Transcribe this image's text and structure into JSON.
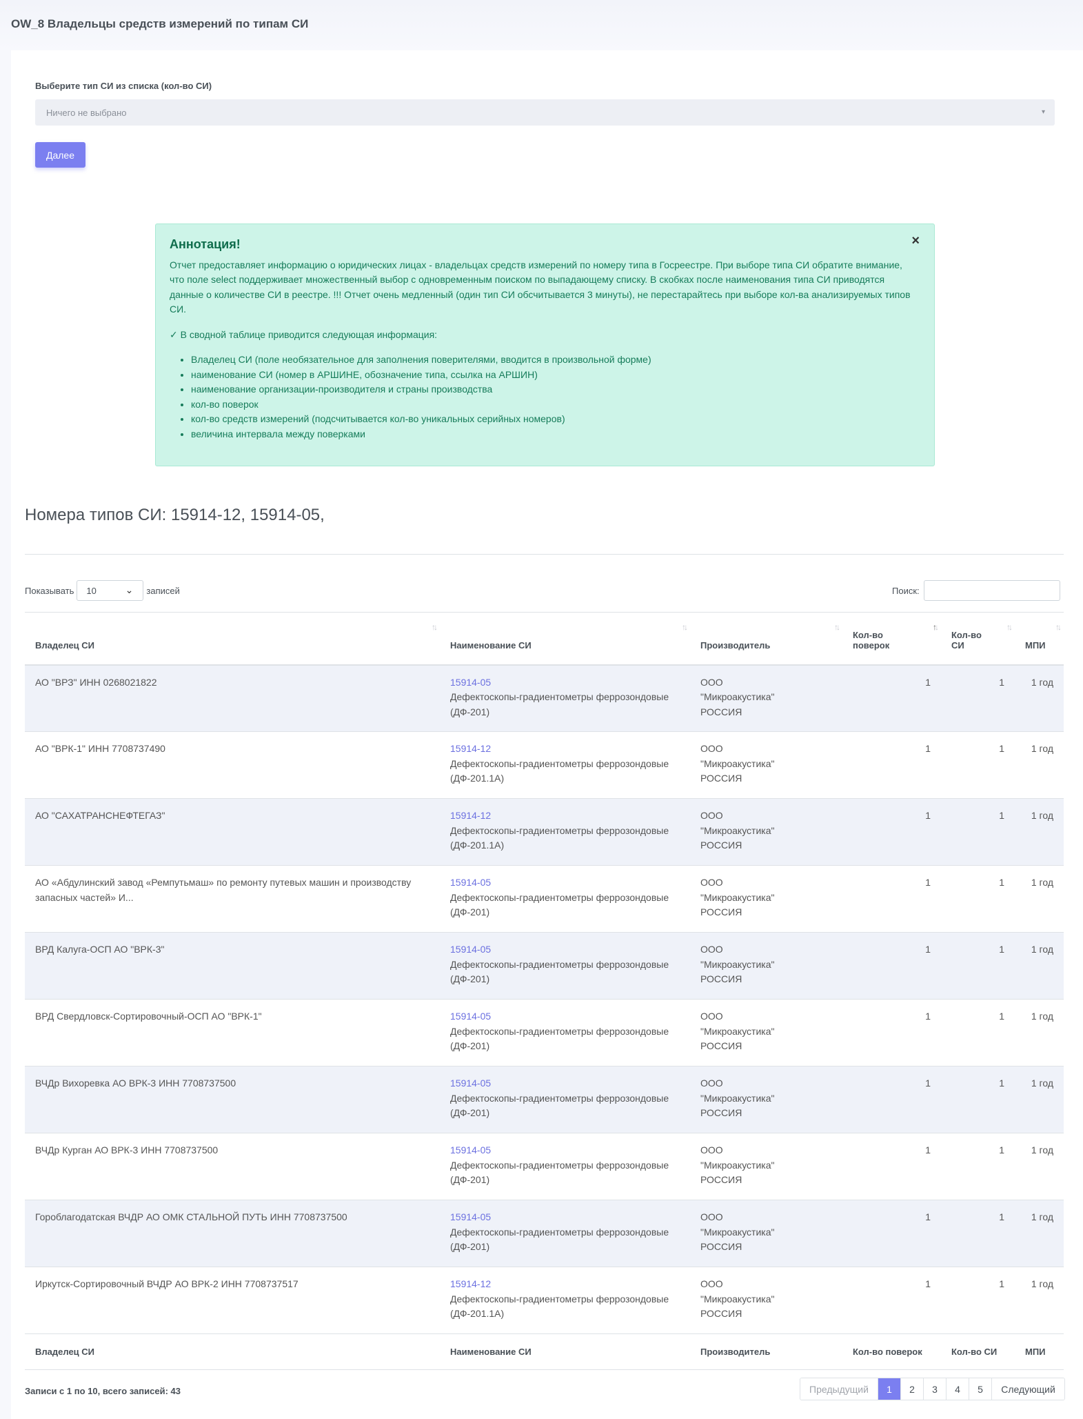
{
  "page": {
    "title": "OW_8 Владельцы средств измерений по типам СИ"
  },
  "form": {
    "label": "Выберите тип СИ из списка (кол-во СИ)",
    "select_placeholder": "Ничего не выбрано",
    "next_button": "Далее"
  },
  "annotation": {
    "title": "Аннотация!",
    "close": "×",
    "text": "Отчет предоставляет информацию о юридических лицах - владельцах средств измерений по номеру типа в Госреестре. При выборе типа СИ обратите внимание, что поле select поддерживает множественный выбор с одновременным поиском по выпадающему списку. В скобках после наименования типа СИ приводятся данные о количестве СИ в реестре. !!! Отчет очень медленный (один тип СИ обсчитывается 3 минуты), не перестарайтесь при выборе кол-ва анализируемых типов СИ.",
    "check_line": "✓ В сводной таблице приводится следующая информация:",
    "items": [
      "Владелец СИ (поле необязательное для заполнения поверителями, вводится в произвольной форме)",
      "наименование СИ (номер в АРШИНЕ, обозначение типа, ссылка на АРШИН)",
      "наименование организации-производителя и страны производства",
      "кол-во поверок",
      "кол-во средств измерений (подсчитывается кол-во уникальных серийных номеров)",
      "величина интервала между поверками"
    ]
  },
  "types_heading": "Номера типов СИ: 15914-12, 15914-05,",
  "table_controls": {
    "show_label": "Показывать",
    "length_value": "10",
    "records_label": "записей",
    "search_label": "Поиск:"
  },
  "table": {
    "headers": [
      "Владелец СИ",
      "Наименование СИ",
      "Производитель",
      "Кол-во поверок",
      "Кол-во СИ",
      "МПИ"
    ],
    "rows": [
      {
        "owner": "АО \"ВРЗ\" ИНН 0268021822",
        "type_no": "15914-05",
        "name": "Дефектоскопы-градиентометры феррозондовые (ДФ-201)",
        "maker": "ООО \"Микроакустика\" РОССИЯ",
        "verifications": "1",
        "count": "1",
        "mpi": "1 год"
      },
      {
        "owner": "АО \"ВРК-1\" ИНН 7708737490",
        "type_no": "15914-12",
        "name": "Дефектоскопы-градиентометры феррозондовые (ДФ-201.1А)",
        "maker": "ООО \"Микроакустика\" РОССИЯ",
        "verifications": "1",
        "count": "1",
        "mpi": "1 год"
      },
      {
        "owner": "АО \"САХАТРАНСНЕФТЕГАЗ\"",
        "type_no": "15914-12",
        "name": "Дефектоскопы-градиентометры феррозондовые (ДФ-201.1А)",
        "maker": "ООО \"Микроакустика\" РОССИЯ",
        "verifications": "1",
        "count": "1",
        "mpi": "1 год"
      },
      {
        "owner": "АО «Абдулинский завод «Ремпутьмаш» по ремонту путевых машин и производству запасных частей» И...",
        "type_no": "15914-05",
        "name": "Дефектоскопы-градиентометры феррозондовые (ДФ-201)",
        "maker": "ООО \"Микроакустика\" РОССИЯ",
        "verifications": "1",
        "count": "1",
        "mpi": "1 год"
      },
      {
        "owner": "ВРД Калуга-ОСП АО \"ВРК-3\"",
        "type_no": "15914-05",
        "name": "Дефектоскопы-градиентометры феррозондовые (ДФ-201)",
        "maker": "ООО \"Микроакустика\" РОССИЯ",
        "verifications": "1",
        "count": "1",
        "mpi": "1 год"
      },
      {
        "owner": "ВРД Свердловск-Сортировочный-ОСП АО \"ВРК-1\"",
        "type_no": "15914-05",
        "name": "Дефектоскопы-градиентометры феррозондовые (ДФ-201)",
        "maker": "ООО \"Микроакустика\" РОССИЯ",
        "verifications": "1",
        "count": "1",
        "mpi": "1 год"
      },
      {
        "owner": "ВЧДр Вихоревка АО ВРК-3 ИНН 7708737500",
        "type_no": "15914-05",
        "name": "Дефектоскопы-градиентометры феррозондовые (ДФ-201)",
        "maker": "ООО \"Микроакустика\" РОССИЯ",
        "verifications": "1",
        "count": "1",
        "mpi": "1 год"
      },
      {
        "owner": "ВЧДр Курган АО ВРК-3 ИНН 7708737500",
        "type_no": "15914-05",
        "name": "Дефектоскопы-градиентометры феррозондовые (ДФ-201)",
        "maker": "ООО \"Микроакустика\" РОССИЯ",
        "verifications": "1",
        "count": "1",
        "mpi": "1 год"
      },
      {
        "owner": "Гороблагодатская ВЧДР АО ОМК СТАЛЬНОЙ ПУТЬ ИНН 7708737500",
        "type_no": "15914-05",
        "name": "Дефектоскопы-градиентометры феррозондовые (ДФ-201)",
        "maker": "ООО \"Микроакустика\" РОССИЯ",
        "verifications": "1",
        "count": "1",
        "mpi": "1 год"
      },
      {
        "owner": "Иркутск-Сортировочный ВЧДР АО ВРК-2 ИНН 7708737517",
        "type_no": "15914-12",
        "name": "Дефектоскопы-градиентометры феррозондовые (ДФ-201.1А)",
        "maker": "ООО \"Микроакустика\" РОССИЯ",
        "verifications": "1",
        "count": "1",
        "mpi": "1 год"
      }
    ],
    "footers": [
      "Владелец СИ",
      "Наименование СИ",
      "Производитель",
      "Кол-во поверок",
      "Кол-во СИ",
      "МПИ"
    ]
  },
  "info": "Записи с 1 по 10, всего записей: 43",
  "pagination": {
    "prev": "Предыдущий",
    "pages": [
      "1",
      "2",
      "3",
      "4",
      "5"
    ],
    "active": "1",
    "next": "Следующий"
  },
  "icons": {
    "sort": "sort-arrows-icon",
    "close": "close-icon",
    "caret": "caret-down-icon",
    "check": "check-icon"
  },
  "colors": {
    "primary": "#7b7ff0",
    "alert_bg": "#cdf4e8",
    "alert_text": "#167c5a",
    "link": "#6b70e0",
    "striped_row": "#eff2f9"
  }
}
